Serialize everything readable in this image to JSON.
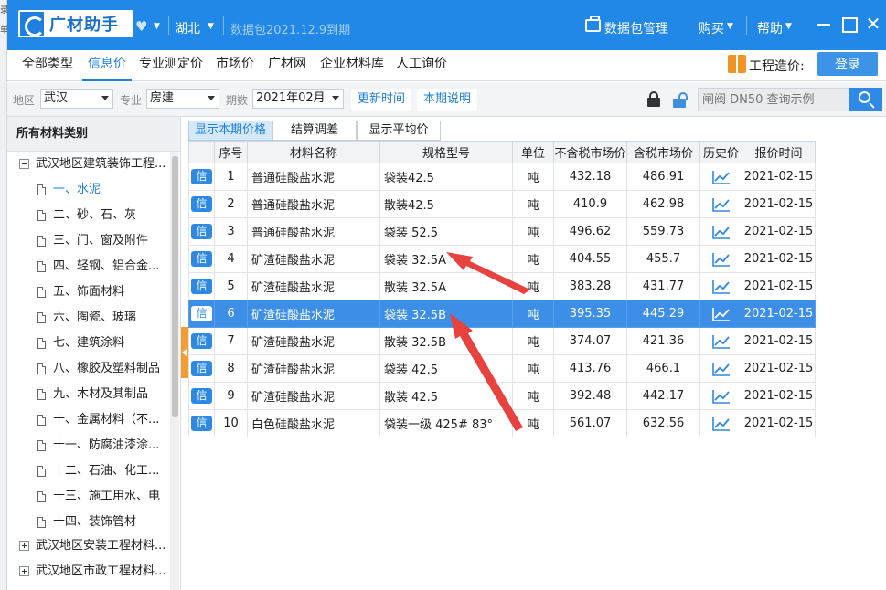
{
  "edge": {
    "chars": [
      "录",
      "单"
    ]
  },
  "titlebar": {
    "brand": "广材助手",
    "region": "湖北",
    "expire": "数据包2021.12.9到期",
    "pkg_manage": "数据包管理",
    "buy": "购买",
    "help": "帮助",
    "close_glyph": "✕"
  },
  "nav": {
    "tabs": [
      "全部类型",
      "信息价",
      "专业测定价",
      "市场价",
      "广材网",
      "企业材料库",
      "人工询价"
    ],
    "active_index": 1,
    "engineering": "工程造价:",
    "login": "登录"
  },
  "filter": {
    "region_label": "地区",
    "region_value": "武汉",
    "major_label": "专业",
    "major_value": "房建",
    "period_label": "期数",
    "period_value": "2021年02月",
    "update_time": "更新时间",
    "period_note": "本期说明",
    "search_placeholder": "闸阀 DN50 查询示例"
  },
  "sidebar": {
    "title": "所有材料类别",
    "items": [
      {
        "label": "武汉地区建筑装饰工程...",
        "level": 0,
        "toggle": "minus"
      },
      {
        "label": "一、水泥",
        "level": 1,
        "selected": true
      },
      {
        "label": "二、砂、石、灰",
        "level": 1
      },
      {
        "label": "三、门、窗及附件",
        "level": 1
      },
      {
        "label": "四、轻钢、铝合金...",
        "level": 1
      },
      {
        "label": "五、饰面材料",
        "level": 1
      },
      {
        "label": "六、陶瓷、玻璃",
        "level": 1
      },
      {
        "label": "七、建筑涂料",
        "level": 1
      },
      {
        "label": "八、橡胶及塑料制品",
        "level": 1
      },
      {
        "label": "九、木材及其制品",
        "level": 1
      },
      {
        "label": "十、金属材料（不...",
        "level": 1
      },
      {
        "label": "十一、防腐油漆涂...",
        "level": 1
      },
      {
        "label": "十二、石油、化工...",
        "level": 1
      },
      {
        "label": "十三、施工用水、电",
        "level": 1
      },
      {
        "label": "十四、装饰管材",
        "level": 1
      },
      {
        "label": "武汉地区安装工程材料...",
        "level": 0,
        "toggle": "plus"
      },
      {
        "label": "武汉地区市政工程材料...",
        "level": 0,
        "toggle": "plus"
      }
    ]
  },
  "subtabs": [
    "显示本期价格",
    "结算调差",
    "显示平均价"
  ],
  "table": {
    "headers": [
      "",
      "序号",
      "材料名称",
      "规格型号",
      "单位",
      "不含税市场价",
      "含税市场价",
      "历史价",
      "报价时间"
    ],
    "badge": "信",
    "selected_row": 5,
    "rows": [
      {
        "no": "1",
        "name": "普通硅酸盐水泥",
        "spec": "袋装42.5",
        "unit": "吨",
        "price_ex": "432.18",
        "price_in": "486.91",
        "date": "2021-02-15"
      },
      {
        "no": "2",
        "name": "普通硅酸盐水泥",
        "spec": "散装42.5",
        "unit": "吨",
        "price_ex": "410.9",
        "price_in": "462.98",
        "date": "2021-02-15"
      },
      {
        "no": "3",
        "name": "普通硅酸盐水泥",
        "spec": "袋装 52.5",
        "unit": "吨",
        "price_ex": "496.62",
        "price_in": "559.73",
        "date": "2021-02-15"
      },
      {
        "no": "4",
        "name": "矿渣硅酸盐水泥",
        "spec": "袋装 32.5A",
        "unit": "吨",
        "price_ex": "404.55",
        "price_in": "455.7",
        "date": "2021-02-15"
      },
      {
        "no": "5",
        "name": "矿渣硅酸盐水泥",
        "spec": "散装 32.5A",
        "unit": "吨",
        "price_ex": "383.28",
        "price_in": "431.77",
        "date": "2021-02-15"
      },
      {
        "no": "6",
        "name": "矿渣硅酸盐水泥",
        "spec": "袋装 32.5B",
        "unit": "吨",
        "price_ex": "395.35",
        "price_in": "445.29",
        "date": "2021-02-15"
      },
      {
        "no": "7",
        "name": "矿渣硅酸盐水泥",
        "spec": "散装 32.5B",
        "unit": "吨",
        "price_ex": "374.07",
        "price_in": "421.36",
        "date": "2021-02-15"
      },
      {
        "no": "8",
        "name": "矿渣硅酸盐水泥",
        "spec": "袋装 42.5",
        "unit": "吨",
        "price_ex": "413.76",
        "price_in": "466.1",
        "date": "2021-02-15"
      },
      {
        "no": "9",
        "name": "矿渣硅酸盐水泥",
        "spec": "散装 42.5",
        "unit": "吨",
        "price_ex": "392.48",
        "price_in": "442.17",
        "date": "2021-02-15"
      },
      {
        "no": "10",
        "name": "白色硅酸盐水泥",
        "spec": "袋装一级 425# 83°",
        "unit": "吨",
        "price_ex": "561.07",
        "price_in": "632.56",
        "date": "2021-02-15"
      }
    ]
  },
  "colors": {
    "brand": "#2188e8",
    "selected": "#3d8ee6",
    "accent": "#f39422",
    "annotation": "#e8423f"
  }
}
